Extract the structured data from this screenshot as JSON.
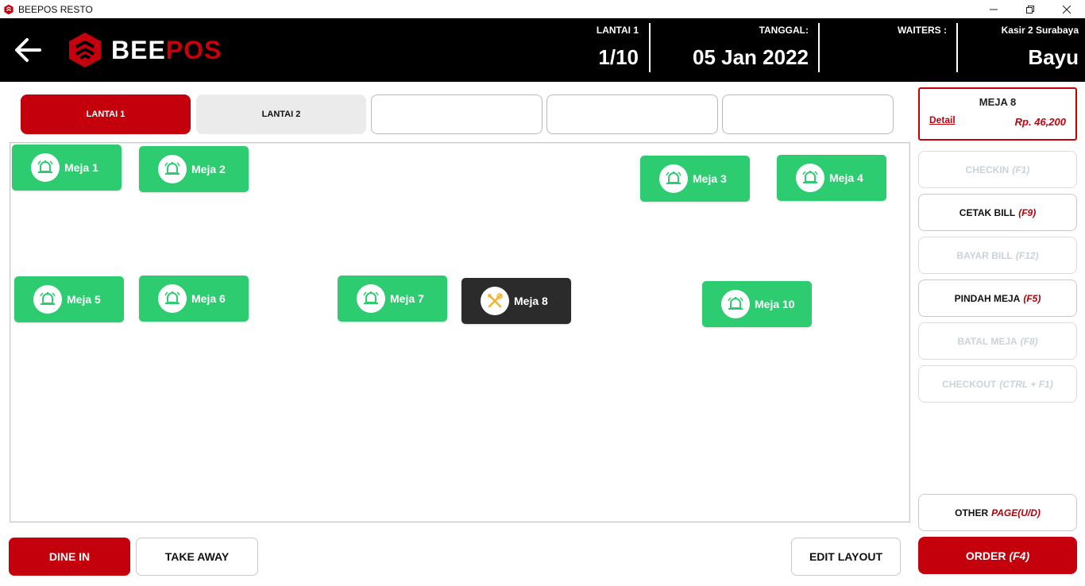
{
  "window": {
    "title": "BEEPOS RESTO",
    "minimize_icon": "minimize-icon",
    "restore_icon": "restore-icon",
    "close_icon": "close-icon"
  },
  "header": {
    "brand_part1": "BEE",
    "brand_part2": "POS",
    "floor_label": "LANTAI 1",
    "floor_value": "1/10",
    "date_label": "TANGGAL:",
    "date_value": "05 Jan 2022",
    "waiters_label": "WAITERS :",
    "cashier_label": "Kasir 2 Surabaya",
    "cashier_value": "Bayu",
    "accent_color": "#c4000c"
  },
  "floor_tabs": [
    {
      "label": "LANTAI 1",
      "active": true
    },
    {
      "label": "LANTAI 2",
      "active": false
    },
    {
      "label": "",
      "active": false
    },
    {
      "label": "",
      "active": false
    },
    {
      "label": "",
      "active": false
    }
  ],
  "tables": [
    {
      "name": "Meja 1",
      "status": "available",
      "icon": "bell-icon"
    },
    {
      "name": "Meja 2",
      "status": "available",
      "icon": "bell-icon"
    },
    {
      "name": "Meja 3",
      "status": "available",
      "icon": "bell-icon"
    },
    {
      "name": "Meja 4",
      "status": "available",
      "icon": "bell-icon"
    },
    {
      "name": "Meja 5",
      "status": "available",
      "icon": "bell-icon"
    },
    {
      "name": "Meja 6",
      "status": "available",
      "icon": "bell-icon"
    },
    {
      "name": "Meja 7",
      "status": "available",
      "icon": "bell-icon"
    },
    {
      "name": "Meja 8",
      "status": "occupied",
      "icon": "utensils-icon"
    },
    {
      "name": "Meja 10",
      "status": "available",
      "icon": "bell-icon"
    }
  ],
  "status_colors": {
    "available": "#2ecc71",
    "occupied": "#2b2b2b"
  },
  "selected_table": {
    "title": "MEJA 8",
    "detail_link": "Detail",
    "price": "Rp. 46,200"
  },
  "actions": [
    {
      "label": "CHECKIN",
      "key": "(F1)",
      "enabled": false
    },
    {
      "label": "CETAK BILL",
      "key": "(F9)",
      "enabled": true
    },
    {
      "label": "BAYAR BILL",
      "key": "(F12)",
      "enabled": false
    },
    {
      "label": "PINDAH MEJA",
      "key": "(F5)",
      "enabled": true
    },
    {
      "label": "BATAL MEJA",
      "key": "(F8)",
      "enabled": false
    },
    {
      "label": "CHECKOUT",
      "key": "(CTRL + F1)",
      "enabled": false
    }
  ],
  "other_page": {
    "label": "OTHER",
    "key": "PAGE(U/D)"
  },
  "order": {
    "label": "ORDER",
    "key": "(F4)"
  },
  "bottom": {
    "dine_in": "DINE IN",
    "take_away": "TAKE AWAY",
    "edit_layout": "EDIT LAYOUT"
  }
}
